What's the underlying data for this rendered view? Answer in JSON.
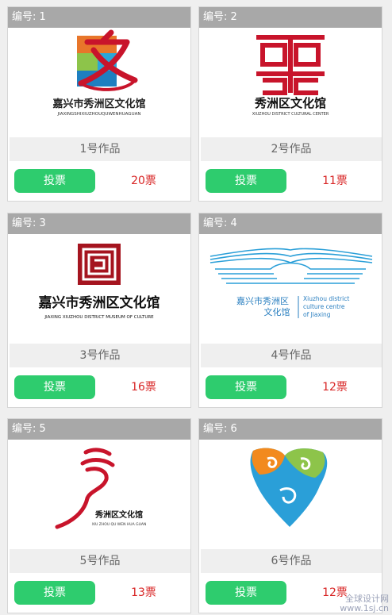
{
  "cards": [
    {
      "number_label": "编号: 1",
      "name": "1号作品",
      "vote_label": "投票",
      "votes": "20票",
      "logo_text": "嘉兴市秀洲区文化馆",
      "logo_subtext": "JIAXINGSHIXIUZHOUQUWENHUAGUAN"
    },
    {
      "number_label": "编号: 2",
      "name": "2号作品",
      "vote_label": "投票",
      "votes": "11票",
      "logo_text": "秀洲区文化馆",
      "logo_subtext": "XIUZHOU DISTRICT CULTURAL CENTER"
    },
    {
      "number_label": "编号: 3",
      "name": "3号作品",
      "vote_label": "投票",
      "votes": "16票",
      "logo_text": "嘉兴市秀洲区文化馆",
      "logo_subtext": "JIAXING XIUZHOU DISTRICT MUSEUM OF CULTURE"
    },
    {
      "number_label": "编号: 4",
      "name": "4号作品",
      "vote_label": "投票",
      "votes": "12票",
      "logo_text_1": "嘉兴市秀洲区",
      "logo_text_2": "文化馆",
      "logo_en_1": "Xiuzhou district",
      "logo_en_2": "culture centre",
      "logo_en_3": "of Jiaxing"
    },
    {
      "number_label": "编号: 5",
      "name": "5号作品",
      "vote_label": "投票",
      "votes": "13票",
      "logo_text": "秀洲区文化馆",
      "logo_subtext": "XIU ZHOU QU WEN HUA GUAN"
    },
    {
      "number_label": "编号: 6",
      "name": "6号作品",
      "vote_label": "投票",
      "votes": "12票"
    }
  ],
  "watermark": {
    "line1": "全球设计网",
    "line2": "www.1sj.cn"
  },
  "colors": {
    "header": "#a8a8a8",
    "vote_button": "#2ecc6e",
    "vote_count": "#d82424"
  }
}
